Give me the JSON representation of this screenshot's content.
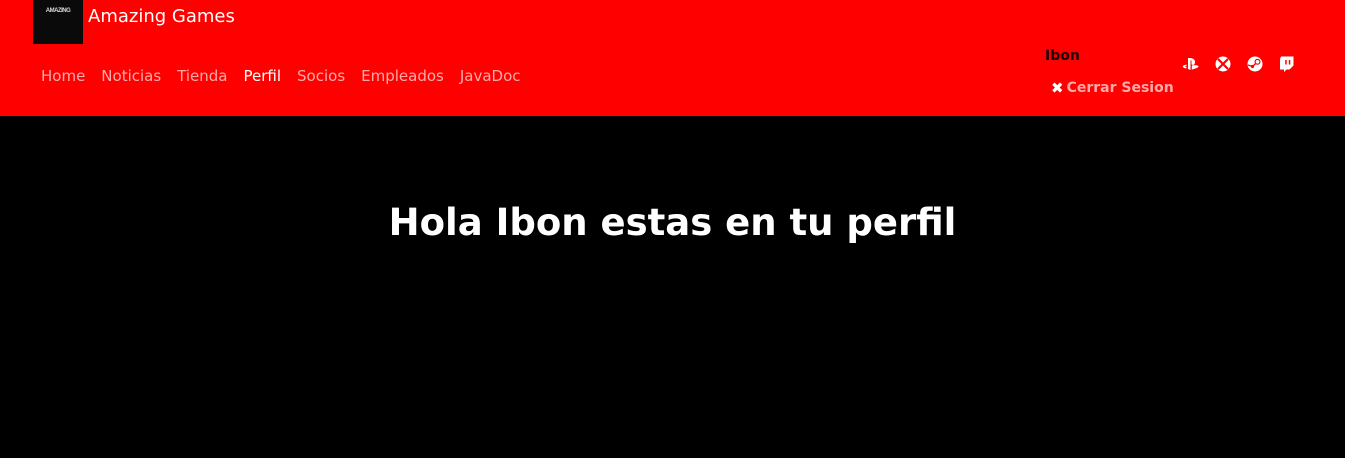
{
  "header": {
    "logo_text": "AMAZING",
    "brand_name": "Amazing Games",
    "nav_items": [
      {
        "label": "Home",
        "active": false
      },
      {
        "label": "Noticias",
        "active": false
      },
      {
        "label": "Tienda",
        "active": false
      },
      {
        "label": "Perfil",
        "active": true
      },
      {
        "label": "Socios",
        "active": false
      },
      {
        "label": "Empleados",
        "active": false
      },
      {
        "label": "JavaDoc",
        "active": false
      }
    ],
    "user_name": "Ibon",
    "logout_label": "Cerrar Sesion",
    "logout_icon": "close-x-icon",
    "platform_icons": [
      "playstation-icon",
      "xbox-icon",
      "steam-icon",
      "twitch-icon"
    ]
  },
  "main": {
    "welcome_text": "Hola Ibon estas en tu perfil"
  },
  "colors": {
    "header_bg": "#ff0000",
    "page_bg": "#000000",
    "nav_inactive": "#ffaaaa",
    "nav_active": "#ffffff"
  }
}
